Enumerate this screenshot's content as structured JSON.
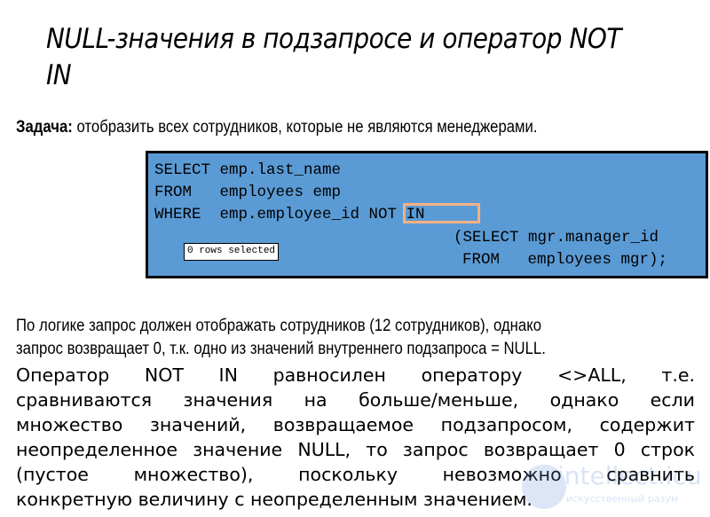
{
  "slide": {
    "title": "NULL-значения в подзапросе и оператор NOT IN",
    "task": {
      "label": "Задача:",
      "text": " отобразить всех сотрудников, которые не являются менеджерами."
    },
    "code": {
      "lines": [
        "SELECT emp.last_name",
        "FROM   employees emp",
        "WHERE  emp.employee_id NOT IN",
        "(SELECT mgr.manager_id",
        "FROM   employees mgr);"
      ],
      "highlighted": "NOT IN",
      "result_badge": "0 rows selected",
      "background_color": "#5b9bd5",
      "highlight_color": "#f4b183"
    },
    "paragraph1": {
      "lines": [
        "По логике запрос должен отображать сотрудников (12 сотрудников), однако",
        "запрос возвращает 0, т.к. одно из значений внутреннего подзапроса = NULL."
      ]
    },
    "paragraph2": {
      "lines": [
        "Оператор NOT IN равносилен оператору <>ALL, т.е.",
        "сравниваются значения на больше/меньше, однако если",
        "множество значений, возвращаемое подзапросом, содержит",
        "неопределенное значение NULL, то запрос возвращает 0 строк",
        "(пустое множество), поскольку невозможно сравнить",
        "конкретную величину с неопределенным значением."
      ]
    },
    "watermark": {
      "text": "intellect.icu",
      "subtext": "искусственный разум"
    }
  }
}
